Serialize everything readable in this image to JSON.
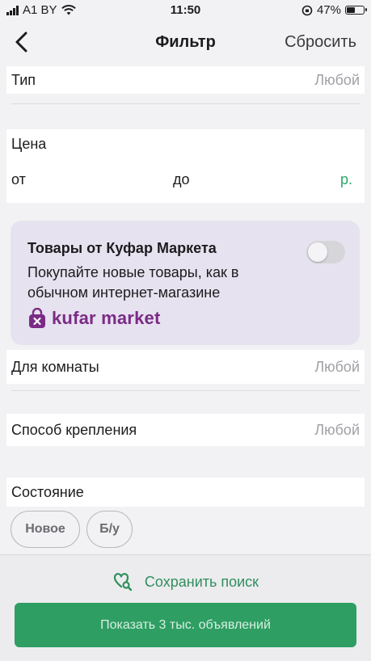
{
  "status_bar": {
    "carrier": "A1 BY",
    "time": "11:50",
    "battery": "47%"
  },
  "nav": {
    "title": "Фильтр",
    "reset_label": "Сбросить"
  },
  "filters": {
    "type": {
      "label": "Тип",
      "value": "Любой"
    },
    "price": {
      "label": "Цена",
      "from_label": "от",
      "to_label": "до",
      "currency": "р."
    },
    "room": {
      "label": "Для комнаты",
      "value": "Любой"
    },
    "mount": {
      "label": "Способ крепления",
      "value": "Любой"
    },
    "condition": {
      "label": "Состояние",
      "options": [
        "Новое",
        "Б/у"
      ]
    }
  },
  "promo": {
    "title": "Товары от Куфар Маркета",
    "text": "Покупайте новые товары, как в обычном интернет-магазине",
    "logo_text": "kufar market",
    "toggle_on": false
  },
  "bottom": {
    "save_search_label": "Сохранить поиск",
    "show_button_label": "Показать 3 тыс. объявлений"
  },
  "colors": {
    "accent_green": "#2e9e63",
    "kufar_purple": "#7b2b86"
  },
  "icons": {
    "back": "chevron-left-icon",
    "save_search": "heart-search-icon",
    "logo": "shopping-bag-icon"
  }
}
